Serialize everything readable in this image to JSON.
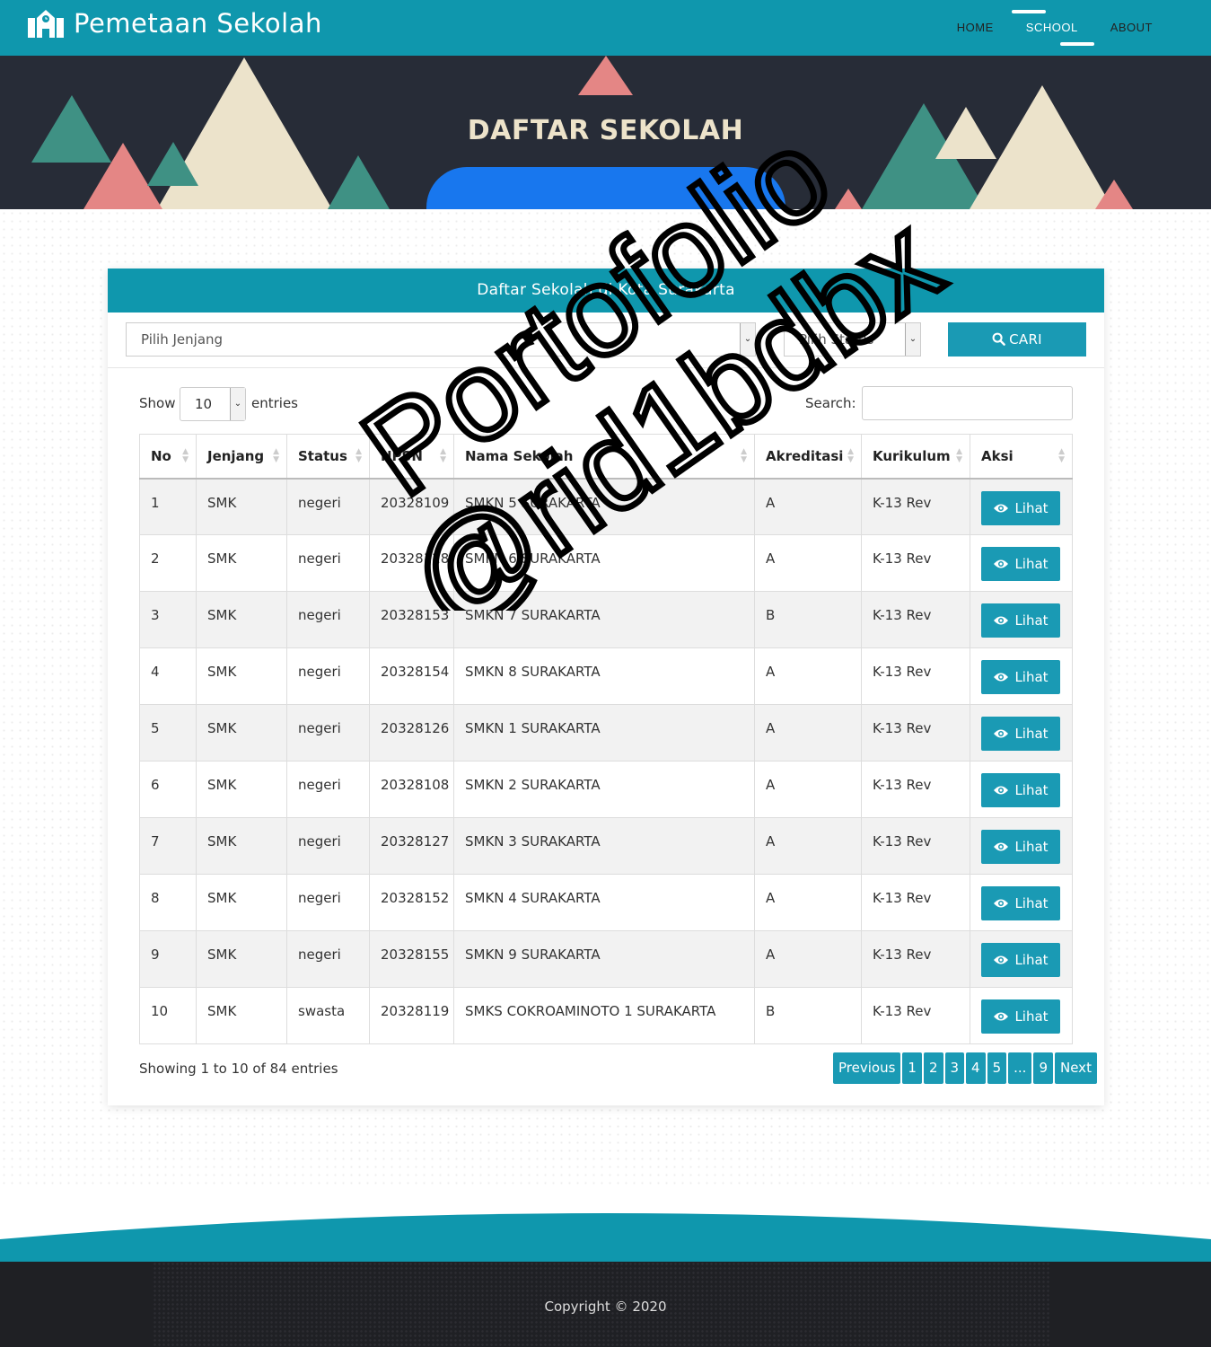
{
  "brand": {
    "name": "Pemetaan Sekolah",
    "icon": "school-building-icon"
  },
  "nav": {
    "items": [
      "HOME",
      "SCHOOL",
      "ABOUT"
    ],
    "active": "SCHOOL"
  },
  "hero": {
    "title": "DAFTAR SEKOLAH"
  },
  "card": {
    "title": "Daftar Sekolah di Kota Surakarta"
  },
  "filters": {
    "jenjang_value": "Pilih Jenjang",
    "status_value": "Pilih Status",
    "search_button": "CARI",
    "search_icon": "magnifier-icon"
  },
  "controls": {
    "show_label": "Show",
    "length_value": "10",
    "entries_label": "entries",
    "search_label": "Search:"
  },
  "table": {
    "columns": [
      "No",
      "Jenjang",
      "Status",
      "NPSN",
      "Nama Sekolah",
      "Akreditasi",
      "Kurikulum",
      "Aksi"
    ],
    "action_label": "Lihat",
    "action_icon": "eye-icon",
    "rows": [
      [
        "1",
        "SMK",
        "negeri",
        "20328109",
        "SMKN 5 SURAKARTA",
        "A",
        "K-13 Rev"
      ],
      [
        "2",
        "SMK",
        "negeri",
        "20328128",
        "SMKN 6 SURAKARTA",
        "A",
        "K-13 Rev"
      ],
      [
        "3",
        "SMK",
        "negeri",
        "20328153",
        "SMKN 7 SURAKARTA",
        "B",
        "K-13 Rev"
      ],
      [
        "4",
        "SMK",
        "negeri",
        "20328154",
        "SMKN 8 SURAKARTA",
        "A",
        "K-13 Rev"
      ],
      [
        "5",
        "SMK",
        "negeri",
        "20328126",
        "SMKN 1 SURAKARTA",
        "A",
        "K-13 Rev"
      ],
      [
        "6",
        "SMK",
        "negeri",
        "20328108",
        "SMKN 2 SURAKARTA",
        "A",
        "K-13 Rev"
      ],
      [
        "7",
        "SMK",
        "negeri",
        "20328127",
        "SMKN 3 SURAKARTA",
        "A",
        "K-13 Rev"
      ],
      [
        "8",
        "SMK",
        "negeri",
        "20328152",
        "SMKN 4 SURAKARTA",
        "A",
        "K-13 Rev"
      ],
      [
        "9",
        "SMK",
        "negeri",
        "20328155",
        "SMKN 9 SURAKARTA",
        "A",
        "K-13 Rev"
      ],
      [
        "10",
        "SMK",
        "swasta",
        "20328119",
        "SMKS COKROAMINOTO 1 SURAKARTA",
        "B",
        "K-13 Rev"
      ]
    ]
  },
  "pagination": {
    "info": "Showing 1 to 10 of 84 entries",
    "buttons": [
      "Previous",
      "1",
      "2",
      "3",
      "4",
      "5",
      "...",
      "9",
      "Next"
    ]
  },
  "footer": {
    "copyright": "Copyright © 2020"
  },
  "watermark": {
    "line1": "Portofolio",
    "line2": "@rid1bdbx"
  },
  "colors": {
    "primary": "#0f97ad",
    "button": "#1a9ab4",
    "hero_bg": "#272c37",
    "hero_title": "#ede3ca",
    "pill_blue": "#1877ee",
    "footer_bg": "#1f2024"
  }
}
